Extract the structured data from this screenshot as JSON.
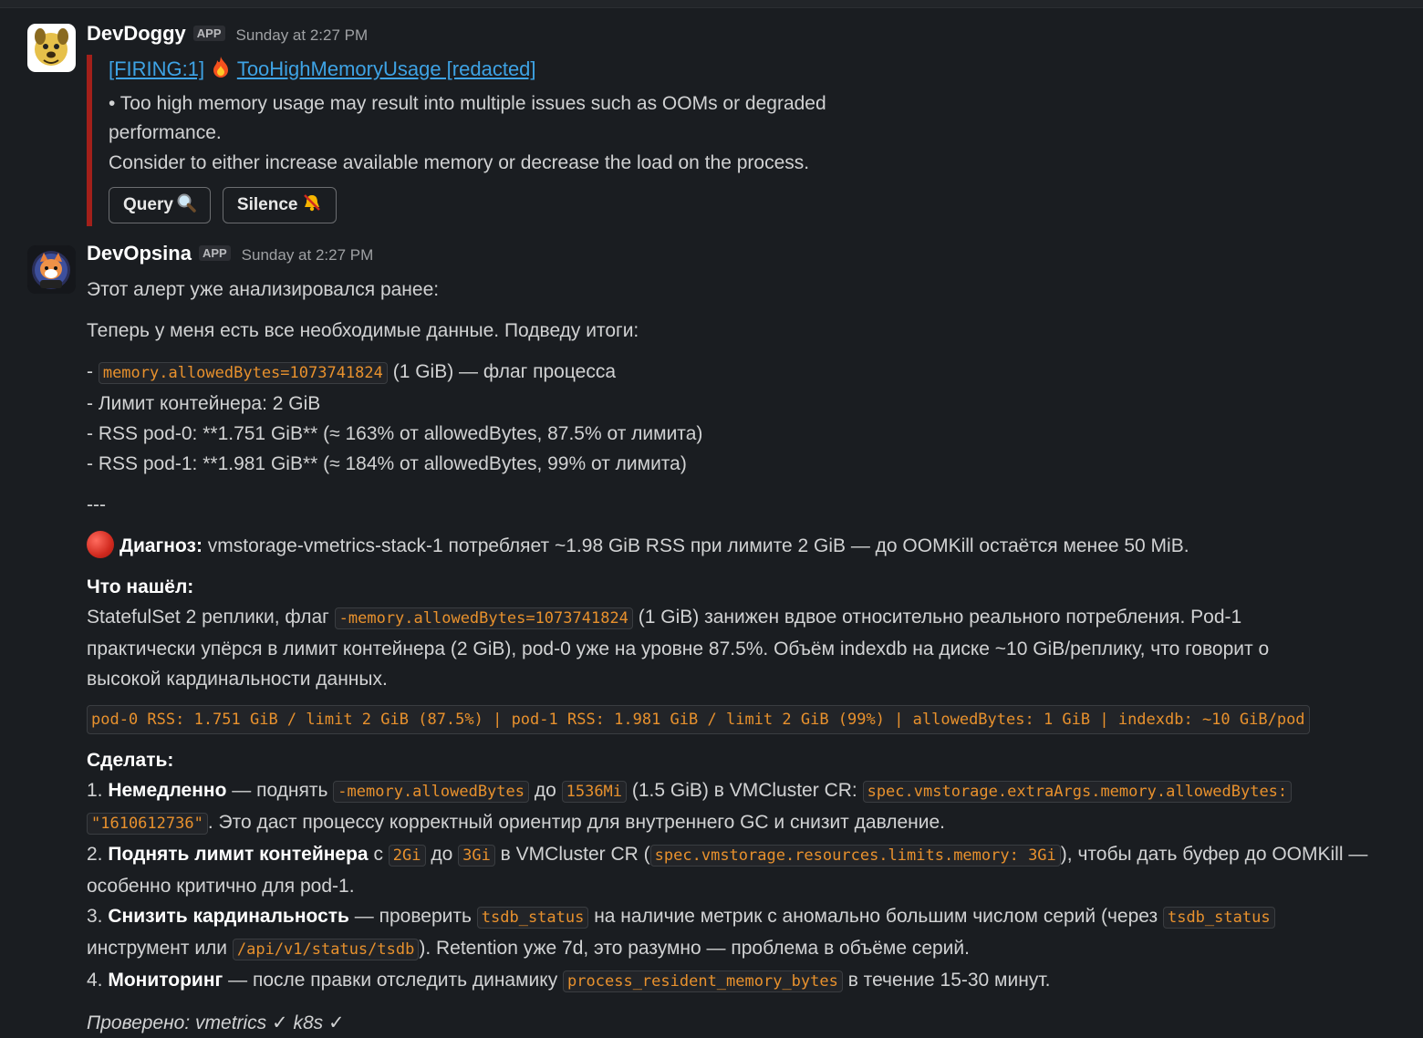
{
  "messages": [
    {
      "sender": "DevDoggy",
      "badge": "APP",
      "timestamp": "Sunday at 2:27 PM",
      "alert": {
        "title_prefix": "[FIRING:1]",
        "title_rest": "TooHighMemoryUsage [redacted]",
        "line1": "• Too high memory usage may result into multiple issues such as OOMs or degraded",
        "line2": "performance.",
        "line3": "Consider to either increase available memory or decrease the load on the process.",
        "buttons": [
          {
            "label": "Query",
            "icon": "magnifier-icon"
          },
          {
            "label": "Silence",
            "icon": "muted-bell-icon"
          }
        ],
        "accent": "#a3201a"
      }
    },
    {
      "sender": "DevOpsina",
      "badge": "APP",
      "timestamp": "Sunday at 2:27 PM",
      "p1": "Этот алерт уже анализировался ранее:",
      "p2": "Теперь у меня есть все необходимые данные. Подведу итоги:",
      "list": {
        "l1_dash": "- ",
        "l1_code": "memory.allowedBytes=1073741824",
        "l1_rest": " (1 GiB) — флаг процесса",
        "l2": "- Лимит контейнера: 2 GiB",
        "l3": "- RSS pod-0: **1.751 GiB** (≈ 163% от allowedBytes, 87.5% от лимита)",
        "l4": "- RSS pod-1: **1.981 GiB** (≈ 184% от allowedBytes, 99% от лимита)"
      },
      "separator": "---",
      "diagnosis": {
        "label": "Диагноз:",
        "text": " vmstorage-vmetrics-stack-1 потребляет ~1.98 GiB RSS при лимите 2 GiB — до OOMKill остаётся менее 50 MiB."
      },
      "found": {
        "heading": "Что нашёл:",
        "t1": "StatefulSet 2 реплики, флаг ",
        "code": "-memory.allowedBytes=1073741824",
        "t2": " (1 GiB) занижен вдвое относительно реального потребления. Pod-1",
        "t3": "практически упёрся в лимит контейнера (2 GiB), pod-0 уже на уровне 87.5%. Объём indexdb на диске ~10 GiB/реплику, что говорит о",
        "t4": "высокой кардинальности данных."
      },
      "codeblock": "pod-0 RSS: 1.751 GiB / limit 2 GiB (87.5%) | pod-1 RSS: 1.981 GiB / limit 2 GiB (99%) | allowedBytes: 1 GiB | indexdb: ~10 GiB/pod",
      "todo": {
        "heading": "Сделать:",
        "s1_num": "1. ",
        "s1_bold": "Немедленно",
        "s1_a": " — поднять ",
        "s1_c1": "-memory.allowedBytes",
        "s1_b": " до ",
        "s1_c2": "1536Mi",
        "s1_c": " (1.5 GiB) в VMCluster CR: ",
        "s1_c3": "spec.vmstorage.extraArgs.memory.allowedBytes:",
        "s1_c4": "\"1610612736\"",
        "s1_d": ". Это даст процессу корректный ориентир для внутреннего GC и снизит давление.",
        "s2_num": "2. ",
        "s2_bold": "Поднять лимит контейнера",
        "s2_a": " с ",
        "s2_c1": "2Gi",
        "s2_b": " до ",
        "s2_c2": "3Gi",
        "s2_c": " в VMCluster CR (",
        "s2_c3": "spec.vmstorage.resources.limits.memory: 3Gi",
        "s2_d": "), чтобы дать буфер до OOMKill —",
        "s2_e": "особенно критично для pod-1.",
        "s3_num": "3. ",
        "s3_bold": "Снизить кардинальность",
        "s3_a": " — проверить ",
        "s3_c1": "tsdb_status",
        "s3_b": " на наличие метрик с аномально большим числом серий (через ",
        "s3_c2": "tsdb_status",
        "s3_c": "инструмент или ",
        "s3_c3": "/api/v1/status/tsdb",
        "s3_d": "). Retention уже 7d, это разумно — проблема в объёме серий.",
        "s4_num": "4. ",
        "s4_bold": "Мониторинг",
        "s4_a": " — после правки отследить динамику ",
        "s4_c1": "process_resident_memory_bytes",
        "s4_b": " в течение 15-30 минут."
      },
      "footer": "Проверено: vmetrics ✓ k8s ✓"
    }
  ]
}
